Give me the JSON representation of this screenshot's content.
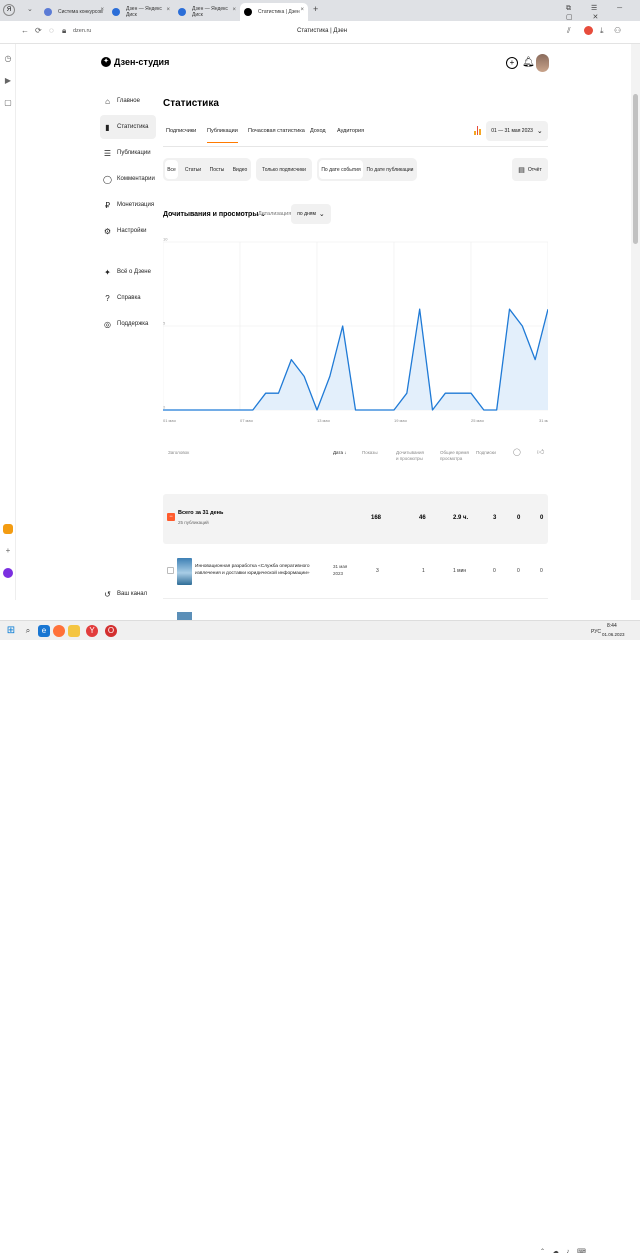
{
  "browser": {
    "tabs": [
      {
        "label": "",
        "active": false
      },
      {
        "label": "Система конкурсов",
        "active": false
      },
      {
        "label": "Дзен — Яндекс Диск",
        "active": false
      },
      {
        "label": "Дзен — Яндекс Диск",
        "active": false
      },
      {
        "label": "Статистика | Дзен",
        "active": true
      }
    ],
    "address": "dzen.ru",
    "page_title": "Статистика | Дзен"
  },
  "logo": "Дзен-студия",
  "sidebar": {
    "items": [
      {
        "label": "Главное",
        "icon": "home-icon"
      },
      {
        "label": "Статистика",
        "icon": "chart-icon",
        "active": true
      },
      {
        "label": "Публикации",
        "icon": "stack-icon"
      },
      {
        "label": "Комментарии",
        "icon": "comment-icon"
      },
      {
        "label": "Монетизация",
        "icon": "ruble-icon"
      },
      {
        "label": "Настройки",
        "icon": "gear-icon"
      },
      {
        "label": "Всё о Дзене",
        "icon": "zen-icon"
      },
      {
        "label": "Справка",
        "icon": "help-icon"
      },
      {
        "label": "Поддержка",
        "icon": "support-icon"
      }
    ],
    "footer": "Ваш канал"
  },
  "main": {
    "title": "Статистика",
    "tabs": [
      "Подписчики",
      "Публикации",
      "Почасовая статистика",
      "Доход",
      "Аудитория"
    ],
    "active_tab": 1,
    "date_range": "01 — 31 мая 2023",
    "filters": [
      "Все",
      "Статьи",
      "Посты",
      "Видео"
    ],
    "only_subscribers": "Только подписчики",
    "date_modes": [
      "По дате события",
      "По дате публикации"
    ],
    "report_button": "Отчёт",
    "metric_selector": "Дочитывания и просмотры",
    "detail_label": "Детализация",
    "detail_value": "по дням"
  },
  "chart_data": {
    "type": "area",
    "x": [
      "01 мая",
      "02",
      "03",
      "04",
      "05",
      "06",
      "07 мая",
      "08",
      "09",
      "10",
      "11",
      "12",
      "13 мая",
      "14",
      "15",
      "16",
      "17",
      "18",
      "19 мая",
      "20",
      "21",
      "22",
      "23",
      "24",
      "25 мая",
      "26",
      "27",
      "28",
      "29",
      "30",
      "31 мая"
    ],
    "tick_labels": [
      "01 мая",
      "07 мая",
      "13 мая",
      "19 мая",
      "25 мая",
      "31 мая"
    ],
    "y_ticks": [
      "10",
      "5",
      "0"
    ],
    "ylim": [
      0,
      10
    ],
    "series": [
      {
        "values": [
          0,
          0,
          0,
          0,
          0,
          0,
          0,
          0,
          1,
          1,
          3,
          2,
          0,
          2,
          5,
          0,
          0,
          0,
          0,
          1,
          6,
          0,
          1,
          1,
          1,
          0,
          0,
          6,
          5,
          3,
          6
        ]
      }
    ],
    "color": "#1f7ad6",
    "fill": "#e3effb"
  },
  "table": {
    "headers": [
      "Заголовок",
      "Дата ↓",
      "Показы",
      "Дочитывания и просмотры",
      "Общее время просмотра",
      "Подписки",
      "",
      ""
    ],
    "summary": {
      "title": "Всего за 31 день",
      "subtitle": "25 публикаций",
      "values": [
        "168",
        "46",
        "2.9 ч.",
        "3",
        "0",
        "0"
      ]
    },
    "rows": [
      {
        "title": "Инновационная разработка «Служба оперативного извлечения и доставки юридической информации»",
        "date": "31 мая 2023",
        "values": [
          "3",
          "1",
          "1 мин",
          "0",
          "0",
          "0"
        ]
      }
    ]
  },
  "taskbar": {
    "time": "8:44",
    "date": "01.06.2023",
    "lang": "РУС"
  }
}
